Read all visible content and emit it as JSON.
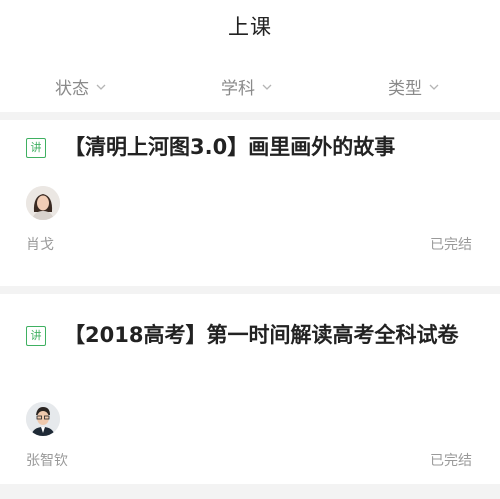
{
  "header": {
    "title": "上课"
  },
  "filters": [
    {
      "label": "状态",
      "icon": "chevron-down-icon"
    },
    {
      "label": "学科",
      "icon": "chevron-down-icon"
    },
    {
      "label": "类型",
      "icon": "chevron-down-icon"
    }
  ],
  "courses": [
    {
      "tag": "讲",
      "title": "【清明上河图3.0】画里画外的故事",
      "teacher": "肖戈",
      "status": "已完结"
    },
    {
      "tag": "讲",
      "title": "【2018高考】第一时间解读高考全科试卷",
      "teacher": "张智钦",
      "status": "已完结"
    }
  ],
  "colors": {
    "accent": "#3fb061",
    "muted": "#9a9a9a",
    "divider": "#f3f3f3"
  }
}
